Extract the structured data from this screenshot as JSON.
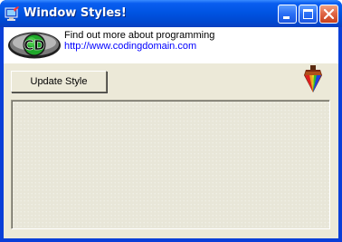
{
  "window": {
    "title": "Window Styles!",
    "controls": {
      "minimize": "minimize-icon",
      "maximize": "maximize-icon",
      "close": "close-icon"
    }
  },
  "banner": {
    "logo_text": "CD",
    "line1": "Find out more about programming",
    "link": "http://www.codingdomain.com"
  },
  "toolbar": {
    "update_label": "Update Style"
  },
  "colors": {
    "titlebar": "#0054e3",
    "client_bg": "#ece9d8",
    "link": "#0000ff",
    "close_button": "#e06848"
  }
}
